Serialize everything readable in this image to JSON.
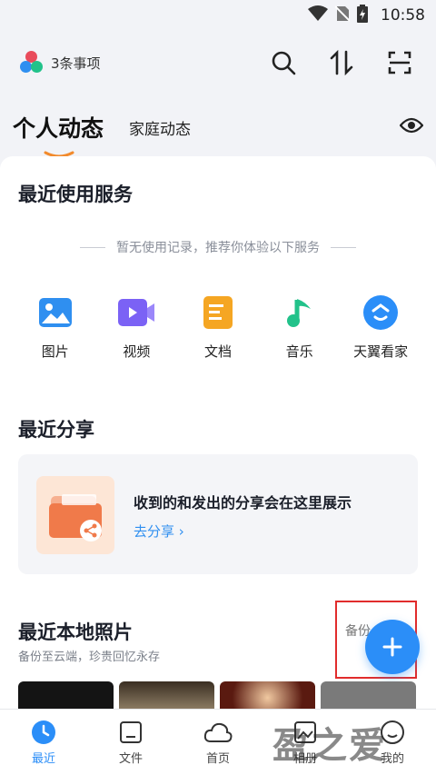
{
  "status_bar": {
    "time": "10:58"
  },
  "header": {
    "todo_label": "3条事项"
  },
  "tabs": {
    "active": "个人动态",
    "inactive": "家庭动态"
  },
  "recent_services": {
    "title": "最近使用服务",
    "empty_hint": "暂无使用记录，推荐你体验以下服务",
    "items": [
      {
        "label": "图片",
        "icon": "image-icon",
        "color": "#2f8ff0"
      },
      {
        "label": "视频",
        "icon": "video-icon",
        "color": "#7b62f5"
      },
      {
        "label": "文档",
        "icon": "document-icon",
        "color": "#f5a623"
      },
      {
        "label": "音乐",
        "icon": "music-icon",
        "color": "#22c28a"
      },
      {
        "label": "天翼看家",
        "icon": "home-camera-icon",
        "color": "#2b8ef8"
      }
    ]
  },
  "recent_share": {
    "title": "最近分享",
    "message": "收到的和发出的分享会在这里展示",
    "link": "去分享 ›"
  },
  "local_photos": {
    "title": "最近本地照片",
    "subtitle": "备份至云端，珍贵回忆永存",
    "backup_label": "备份"
  },
  "bottom_nav": [
    {
      "label": "最近",
      "icon": "clock-icon",
      "active": true
    },
    {
      "label": "文件",
      "icon": "folder-icon",
      "active": false
    },
    {
      "label": "首页",
      "icon": "cloud-icon",
      "active": false
    },
    {
      "label": "相册",
      "icon": "album-icon",
      "active": false
    },
    {
      "label": "我的",
      "icon": "profile-icon",
      "active": false
    }
  ],
  "watermark": "盈之爱",
  "colors": {
    "accent": "#2b8ef8",
    "highlight_box": "#e12c2c"
  }
}
